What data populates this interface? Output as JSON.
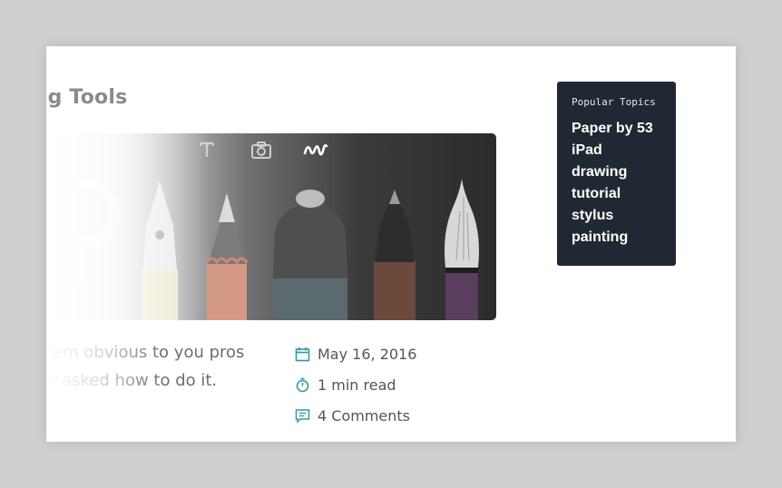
{
  "post": {
    "title_visible": "ing Tools",
    "excerpt": [
      "tem obvious to you pros",
      "n asked how to do it."
    ],
    "date": "May 16, 2016",
    "read_time": "1 min read",
    "comments": "4 Comments"
  },
  "hero": {
    "toolbar_icons": [
      "text-tool-icon",
      "camera-icon",
      "draw-squiggle-icon"
    ],
    "tools": [
      "pen-nib-tool",
      "pencil-tool",
      "marker-tool",
      "fineliner-tool",
      "brush-tool"
    ]
  },
  "sidebar": {
    "heading": "Popular Topics",
    "topics": [
      "Paper by 53",
      "iPad",
      "drawing",
      "tutorial",
      "stylus",
      "painting"
    ]
  },
  "colors": {
    "accent": "#2f9aa6",
    "sidebar_bg": "#202833",
    "page_bg": "#cfcfcf"
  }
}
